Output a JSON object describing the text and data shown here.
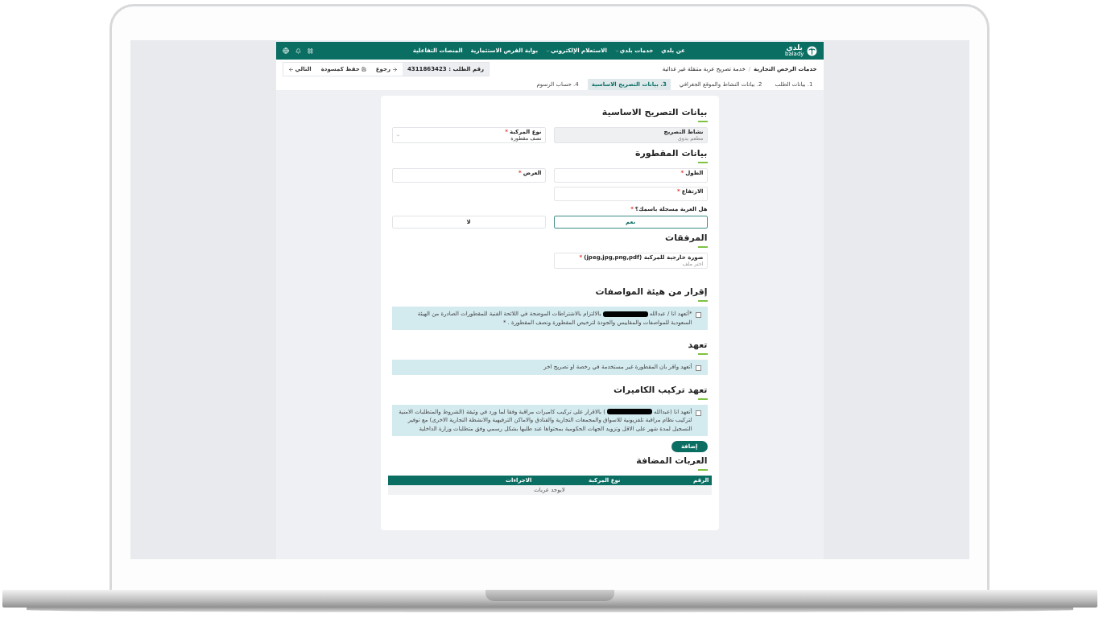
{
  "header": {
    "logo": {
      "name": "بلدي",
      "latin": "balady"
    },
    "nav": [
      {
        "label": "عن بلدي",
        "dropdown": false
      },
      {
        "label": "خدمات بلدي",
        "dropdown": true
      },
      {
        "label": "الاستعلام الإلكتروني",
        "dropdown": true
      },
      {
        "label": "بوابة الفرص الاستثمارية",
        "dropdown": false
      },
      {
        "label": "المنصات التفاعلية",
        "dropdown": false
      }
    ]
  },
  "breadcrumbs": [
    "خدمات الرخص التجارية",
    "خدمة تصريح عربة متنقلة غير غذائية"
  ],
  "breadcrumb_separator": "/",
  "request_number": "رقم الطلب : 4311863423",
  "actions": [
    {
      "kind": "back",
      "label": "رجوع"
    },
    {
      "kind": "draft",
      "label": "حفظ كمسودة"
    },
    {
      "kind": "next",
      "label": "التالي"
    }
  ],
  "steps": [
    {
      "label": "1. بيانات الطلب",
      "selected": false
    },
    {
      "label": "2. بيانات النشاط والموقع الجغرافي",
      "selected": false
    },
    {
      "label": "3. بيانات التصريح الاساسية",
      "selected": true
    },
    {
      "label": "4. حساب الرسوم",
      "selected": false
    }
  ],
  "basic": {
    "title": "بيانات التصريح الاساسية",
    "fields": [
      {
        "kind": "text",
        "label": "نشاط التصريح",
        "value": "مطعم يدوي",
        "disabled": true
      },
      {
        "kind": "select",
        "label": "نوع المركبة",
        "mark": "*",
        "value": "نصف مقطورة",
        "disabled": false
      }
    ]
  },
  "trailer": {
    "title": "بيانات المقطورة",
    "fields": [
      {
        "label": "الطول",
        "mark": "*"
      },
      {
        "label": "العرض",
        "mark": "*"
      },
      {
        "label": "الارتفاع",
        "mark": "*"
      }
    ],
    "question": {
      "label": "هل العربة مسجلة باسمك؟",
      "mark": "*",
      "options": [
        {
          "label": "نعم",
          "selected": true
        },
        {
          "label": "لا",
          "selected": false
        }
      ]
    }
  },
  "attachments": {
    "title": "المرفقات",
    "field": {
      "label": "صورة خارجية للمركبة (jpeg,jpg,png,pdf)",
      "mark": "*",
      "placeholder": "اختر ملف"
    }
  },
  "declarations": [
    {
      "title": "إقرار من هيئة المواصفات",
      "checked": false,
      "before": "*أتعهد انا / عبدالله",
      "redacted": true,
      "after": "بالالتزام بالاشتراطات الموضحة في اللائحة الفنية للمقطورات الصادرة من الهيئة السعودية للمواصفات والمقاييس والجودة لترخيص المقطورة ونصف المقطورة . *"
    },
    {
      "title": "تعهد",
      "checked": false,
      "before": "أتعهد واقر بان المقطورة غير مستخدمة في رخصة او تصريح اخر",
      "redacted": false
    },
    {
      "title": "تعهد تركيب الكاميرات",
      "checked": false,
      "before": "أتعهد انا (عبدالله",
      "redacted": true,
      "after": ") بالاقرار على تركيب كاميرات مراقبة وفقا لما ورد في وثيقة (الشروط والمتطلبات الامنية لتركيب نظام مراقبة تلفزيونية للاسواق والمجمعات التجارية والفنادق والاماكن الترفيهية والانشطة التجارية الاخرى) مع توفير التسجيل لمدة شهر على الاقل وتزويد الجهات الحكومية بمحتواها عند طلبها بشكل رسمي وفق متطلبات وزارة الداخلية"
    }
  ],
  "add_button": "إضافة",
  "vehicles": {
    "title": "العربات المضافة",
    "columns": [
      "الرقم",
      "نوع المركبة",
      "الاجراءات"
    ],
    "empty": "لايوجد عربات"
  }
}
